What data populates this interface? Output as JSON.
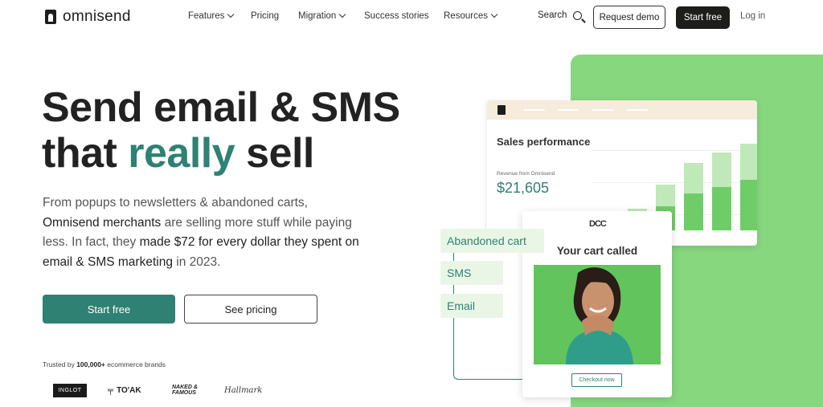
{
  "nav": {
    "brand": "omnisend",
    "items": [
      {
        "label": "Features",
        "dropdown": true
      },
      {
        "label": "Pricing",
        "dropdown": false
      },
      {
        "label": "Migration",
        "dropdown": true
      },
      {
        "label": "Success stories",
        "dropdown": false
      },
      {
        "label": "Resources",
        "dropdown": true
      }
    ],
    "search_label": "Search",
    "request_demo": "Request demo",
    "start_free": "Start free",
    "login": "Log in"
  },
  "hero": {
    "title_line1": "Send email & SMS",
    "title_line2_start": "that ",
    "title_line2_accent": "really",
    "title_line2_end": " sell",
    "desc_part1": "From popups to newsletters & abandoned carts,",
    "desc_part2": "Omnisend merchants",
    "desc_part3": " are selling more stuff while paying less. In fact, they ",
    "desc_part4": "made $72 for every dollar they spent on email & SMS marketing",
    "desc_part5": " in 2023.",
    "cta_primary": "Start free",
    "cta_secondary": "See pricing",
    "trusted_prefix": "Trusted by ",
    "trusted_count": "100,000+",
    "trusted_suffix": " ecommerce brands",
    "brands": {
      "inglot": "INGLOT",
      "toak": "TO'AK",
      "naked": "NAKED & FAMOUS",
      "hallmark": "Hallmark"
    }
  },
  "illustration": {
    "sales_title": "Sales performance",
    "revenue_label": "Revenue from Omnisend",
    "revenue_value": "$21,605",
    "chart_levels": [
      {
        "total": 0.08,
        "part": 0.0
      },
      {
        "total": 0.25,
        "part": 0.05
      },
      {
        "total": 0.53,
        "part": 0.28
      },
      {
        "total": 0.78,
        "part": 0.43
      },
      {
        "total": 0.9,
        "part": 0.5
      },
      {
        "total": 1.0,
        "part": 0.58
      }
    ],
    "cart_logo": "DCC",
    "cart_title": "Your cart called",
    "checkout": "Checkout now",
    "channels": [
      "Abandoned cart",
      "SMS",
      "Email"
    ]
  },
  "colors": {
    "accent_teal": "#2e8173",
    "brand_green": "#86d77e",
    "dark": "#1d1d1b"
  }
}
